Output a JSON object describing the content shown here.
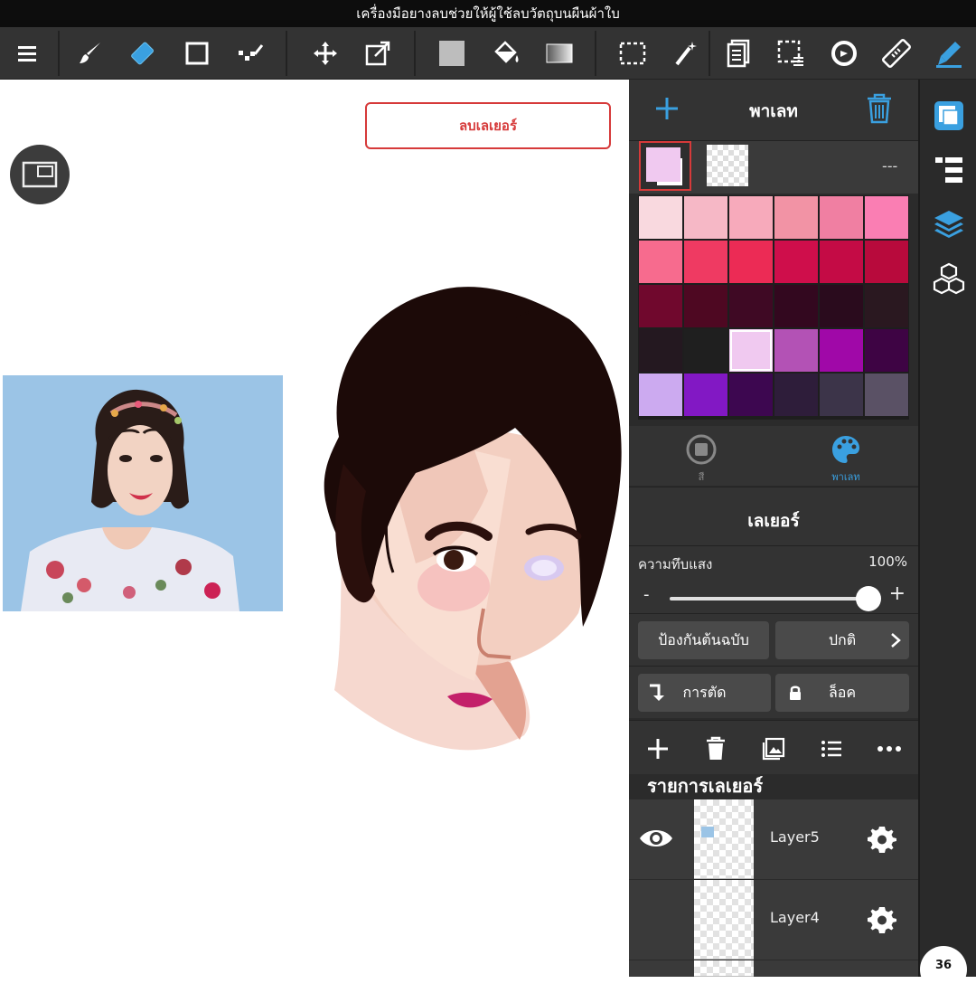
{
  "caption": "เครื่องมือยางลบช่วยให้ผู้ใช้ลบวัตถุบนผืนผ้าใบ",
  "toolbar": {
    "items": [
      "menu-icon",
      "brush-icon",
      "eraser-icon",
      "rectangle-icon",
      "dot-tool-icon",
      "move-icon",
      "transform-icon",
      "fill-color-icon",
      "bucket-icon",
      "gradient-icon",
      "selection-icon",
      "magic-wand-icon",
      "copy-icon",
      "deselect-icon",
      "rotate-icon",
      "ruler-icon",
      "pen-active-icon"
    ],
    "accent": "#3aa0e0"
  },
  "canvas": {
    "delete_layer_label": "ลบเลเยอร์"
  },
  "palette": {
    "title": "พาเลท",
    "dash": "---",
    "active_color": "#f0c9f0",
    "colors": [
      "#f9d9df",
      "#f6b8c6",
      "#f7aabb",
      "#f293a5",
      "#f07fa2",
      "#fa7eb3",
      "#f76b8e",
      "#ef3a62",
      "#ec2b55",
      "#cf0e4b",
      "#c40b45",
      "#b80a3c",
      "#70082d",
      "#4e0822",
      "#3f0924",
      "#33081f",
      "#2a0b1d",
      "#2a1820",
      "#241820",
      "#1f1f1f",
      "#f0c9f0",
      "#b352b5",
      "#a008a8",
      "#3e0444",
      "#ccaaf0",
      "#8218c4",
      "#3d0750",
      "#2e1d3a",
      "#3c3449",
      "#5a5165"
    ],
    "selected_index": 20,
    "tab_color_label": "สี",
    "tab_palette_label": "พาเลท"
  },
  "layer_panel": {
    "title": "เลเยอร์",
    "opacity_label": "ความทึบแสง",
    "opacity_value": "100%",
    "opacity_fraction": 1.0,
    "minus": "-",
    "plus": "+",
    "protect_label": "ป้องกันต้นฉบับ",
    "blend_label": "ปกติ",
    "clip_label": "การตัด",
    "lock_label": "ล็อค",
    "list_title": "รายการเลเยอร์",
    "layers": [
      {
        "name": "Layer5"
      },
      {
        "name": "Layer4"
      }
    ]
  },
  "badge": "36"
}
